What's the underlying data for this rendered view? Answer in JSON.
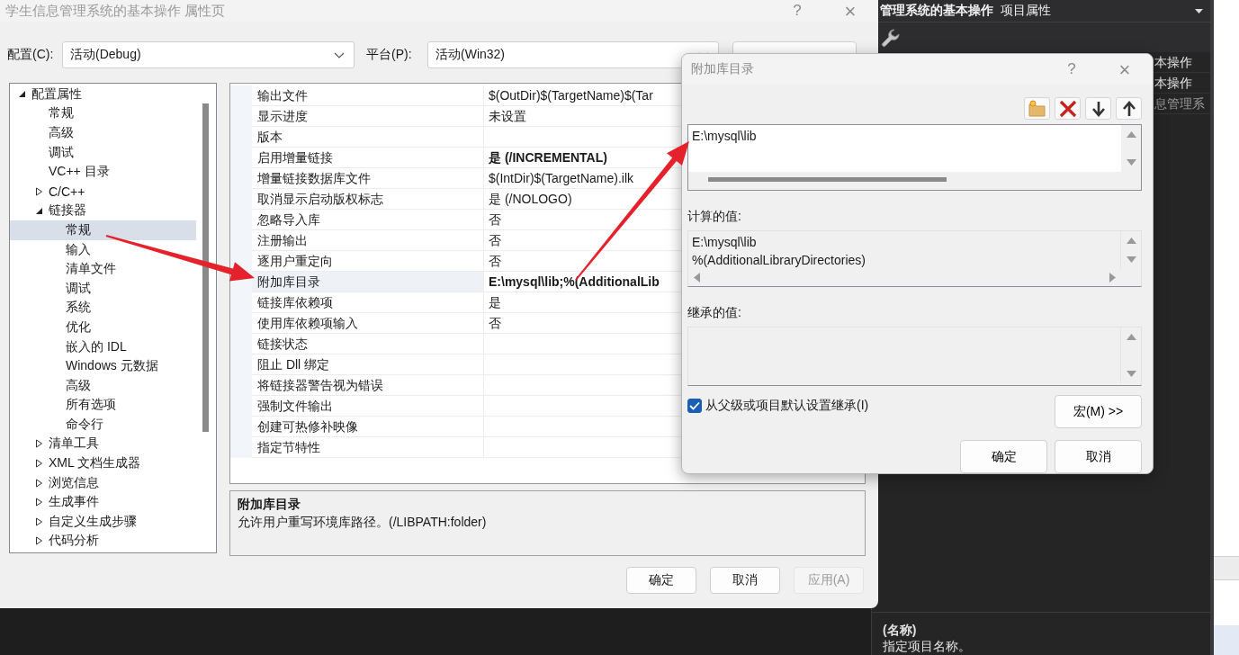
{
  "main_dialog": {
    "title": "学生信息管理系统的基本操作 属性页",
    "help": "?",
    "close": "×",
    "configuration": {
      "label": "配置(C):",
      "value": "活动(Debug)"
    },
    "platform": {
      "label": "平台(P):",
      "value": "活动(Win32)"
    },
    "tree": [
      {
        "label": "配置属性",
        "expanded": true,
        "selected": false,
        "children": [
          {
            "label": "常规",
            "selected": false
          },
          {
            "label": "高级",
            "selected": false
          },
          {
            "label": "调试",
            "selected": false
          },
          {
            "label": "VC++ 目录",
            "selected": false
          },
          {
            "label": "C/C++",
            "expanded": false,
            "selected": false
          },
          {
            "label": "链接器",
            "expanded": true,
            "selected": false,
            "children": [
              {
                "label": "常规",
                "selected": true
              },
              {
                "label": "输入",
                "selected": false
              },
              {
                "label": "清单文件",
                "selected": false
              },
              {
                "label": "调试",
                "selected": false
              },
              {
                "label": "系统",
                "selected": false
              },
              {
                "label": "优化",
                "selected": false
              },
              {
                "label": "嵌入的 IDL",
                "selected": false
              },
              {
                "label": "Windows 元数据",
                "selected": false
              },
              {
                "label": "高级",
                "selected": false
              },
              {
                "label": "所有选项",
                "selected": false
              },
              {
                "label": "命令行",
                "selected": false
              }
            ]
          },
          {
            "label": "清单工具",
            "expanded": false,
            "selected": false
          },
          {
            "label": "XML 文档生成器",
            "expanded": false,
            "selected": false
          },
          {
            "label": "浏览信息",
            "expanded": false,
            "selected": false
          },
          {
            "label": "生成事件",
            "expanded": false,
            "selected": false
          },
          {
            "label": "自定义生成步骤",
            "expanded": false,
            "selected": false
          },
          {
            "label": "代码分析",
            "expanded": false,
            "selected": false
          }
        ]
      }
    ],
    "properties": [
      {
        "name": "输出文件",
        "value": "$(OutDir)$(TargetName)$(Tar",
        "bold": false,
        "selected": false
      },
      {
        "name": "显示进度",
        "value": "未设置",
        "bold": false,
        "selected": false
      },
      {
        "name": "版本",
        "selected": false
      },
      {
        "name": "启用增量链接",
        "value": "是 (/INCREMENTAL)",
        "bold": true,
        "selected": false
      },
      {
        "name": "增量链接数据库文件",
        "value": "$(IntDir)$(TargetName).ilk",
        "bold": false,
        "selected": false
      },
      {
        "name": "取消显示启动版权标志",
        "value": "是 (/NOLOGO)",
        "bold": false,
        "selected": false
      },
      {
        "name": "忽略导入库",
        "value": "否",
        "bold": false,
        "selected": false
      },
      {
        "name": "注册输出",
        "value": "否",
        "bold": false,
        "selected": false
      },
      {
        "name": "逐用户重定向",
        "value": "否",
        "bold": false,
        "selected": false
      },
      {
        "name": "附加库目录",
        "value": "E:\\mysql\\lib;%(AdditionalLib",
        "bold": true,
        "selected": true
      },
      {
        "name": "链接库依赖项",
        "value": "是",
        "bold": false,
        "selected": false
      },
      {
        "name": "使用库依赖项输入",
        "value": "否",
        "bold": false,
        "selected": false
      },
      {
        "name": "链接状态",
        "selected": false
      },
      {
        "name": "阻止 Dll 绑定",
        "selected": false
      },
      {
        "name": "将链接器警告视为错误",
        "selected": false
      },
      {
        "name": "强制文件输出",
        "selected": false
      },
      {
        "name": "创建可热修补映像",
        "selected": false
      },
      {
        "name": "指定节特性",
        "selected": false
      }
    ],
    "description": {
      "title": "附加库目录",
      "text": "允许用户重写环境库路径。(/LIBPATH:folder)"
    },
    "buttons": [
      {
        "label": "确定",
        "disabled": false
      },
      {
        "label": "取消",
        "disabled": false
      },
      {
        "label": "应用(A)",
        "disabled": true
      }
    ]
  },
  "library_dialog": {
    "title": "附加库目录",
    "help": "?",
    "close": "×",
    "toolbar": [
      {
        "kind": "new-folder"
      },
      {
        "kind": "delete"
      },
      {
        "kind": "move-down"
      },
      {
        "kind": "move-up"
      }
    ],
    "entries": [
      "E:\\mysql\\lib"
    ],
    "evaluated_label": "计算的值:",
    "evaluated_lines": [
      "E:\\mysql\\lib",
      "%(AdditionalLibraryDirectories)"
    ],
    "inherited_label": "继承的值:",
    "inherit": {
      "label": "从父级或项目默认设置继承(I)",
      "checked": true
    },
    "macros_button": "宏(M) >>",
    "buttons": [
      {
        "label": "确定"
      },
      {
        "label": "取消"
      }
    ]
  },
  "property_panel": {
    "title_bold": "管理系统的基本操作",
    "title": "项目属性",
    "rows": [
      {
        "text": "本操作",
        "dim": false
      },
      {
        "text": "本操作",
        "dim": false
      },
      {
        "text": "息管理系",
        "dim": true
      }
    ],
    "description": {
      "title": "(名称)",
      "text": "指定项目名称。"
    }
  }
}
